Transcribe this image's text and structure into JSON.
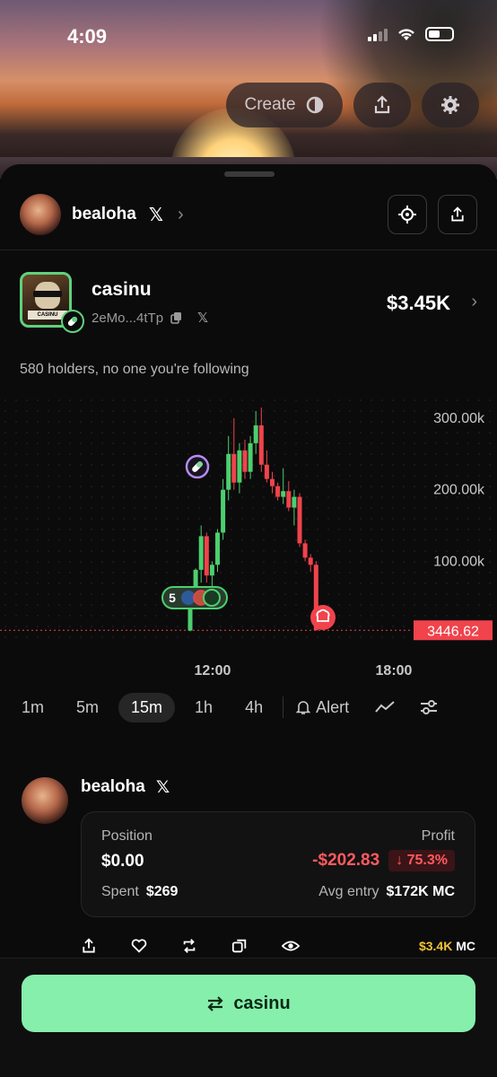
{
  "status_bar": {
    "time": "4:09"
  },
  "top_actions": {
    "create_label": "Create"
  },
  "creator": {
    "name": "bealoha"
  },
  "coin": {
    "name": "casinu",
    "address": "2eMo...4tTp",
    "market_cap": "$3.45K",
    "holders_text": "580 holders, no one you're following",
    "image_sign_text": "CASINU"
  },
  "chart_data": {
    "type": "candlestick",
    "y_ticks": [
      "300.00k",
      "200.00k",
      "100.00k"
    ],
    "x_ticks": [
      "12:00",
      "18:00"
    ],
    "current_price": "3446.62",
    "ylim": [
      0,
      320000
    ],
    "trade_marker_count": "5",
    "candles": [
      {
        "o": 3000,
        "h": 45000,
        "l": 2000,
        "c": 42000
      },
      {
        "o": 42000,
        "h": 90000,
        "l": 38000,
        "c": 88000
      },
      {
        "o": 88000,
        "h": 150000,
        "l": 70000,
        "c": 135000
      },
      {
        "o": 135000,
        "h": 140000,
        "l": 70000,
        "c": 80000
      },
      {
        "o": 80000,
        "h": 100000,
        "l": 60000,
        "c": 95000
      },
      {
        "o": 95000,
        "h": 145000,
        "l": 85000,
        "c": 140000
      },
      {
        "o": 140000,
        "h": 215000,
        "l": 130000,
        "c": 200000
      },
      {
        "o": 200000,
        "h": 275000,
        "l": 185000,
        "c": 250000
      },
      {
        "o": 250000,
        "h": 300000,
        "l": 200000,
        "c": 210000
      },
      {
        "o": 210000,
        "h": 265000,
        "l": 195000,
        "c": 255000
      },
      {
        "o": 255000,
        "h": 270000,
        "l": 215000,
        "c": 225000
      },
      {
        "o": 225000,
        "h": 275000,
        "l": 215000,
        "c": 265000
      },
      {
        "o": 265000,
        "h": 310000,
        "l": 250000,
        "c": 290000
      },
      {
        "o": 290000,
        "h": 315000,
        "l": 225000,
        "c": 235000
      },
      {
        "o": 235000,
        "h": 255000,
        "l": 210000,
        "c": 215000
      },
      {
        "o": 215000,
        "h": 225000,
        "l": 195000,
        "c": 205000
      },
      {
        "o": 205000,
        "h": 210000,
        "l": 185000,
        "c": 190000
      },
      {
        "o": 190000,
        "h": 230000,
        "l": 180000,
        "c": 198000
      },
      {
        "o": 198000,
        "h": 212000,
        "l": 170000,
        "c": 175000
      },
      {
        "o": 175000,
        "h": 200000,
        "l": 150000,
        "c": 190000
      },
      {
        "o": 190000,
        "h": 195000,
        "l": 120000,
        "c": 125000
      },
      {
        "o": 125000,
        "h": 130000,
        "l": 100000,
        "c": 105000
      },
      {
        "o": 105000,
        "h": 110000,
        "l": 85000,
        "c": 95000
      },
      {
        "o": 95000,
        "h": 100000,
        "l": 3000,
        "c": 3446
      }
    ]
  },
  "timeframes": [
    "1m",
    "5m",
    "15m",
    "1h",
    "4h"
  ],
  "active_timeframe": "15m",
  "alert_label": "Alert",
  "position": {
    "trader_name": "bealoha",
    "position_label": "Position",
    "position_value": "$0.00",
    "profit_label": "Profit",
    "profit_value": "-$202.83",
    "profit_pct": "↓ 75.3%",
    "spent_label": "Spent",
    "spent_value": "$269",
    "avg_entry_label": "Avg entry",
    "avg_entry_value": "$172K MC",
    "mc_value": "$3.4K",
    "mc_suffix": "MC"
  },
  "buy_button": {
    "label": "casinu"
  },
  "colors": {
    "up": "#4ccf6e",
    "down": "#f0434c",
    "accent": "#86efac",
    "price_tag": "#f0434c"
  }
}
